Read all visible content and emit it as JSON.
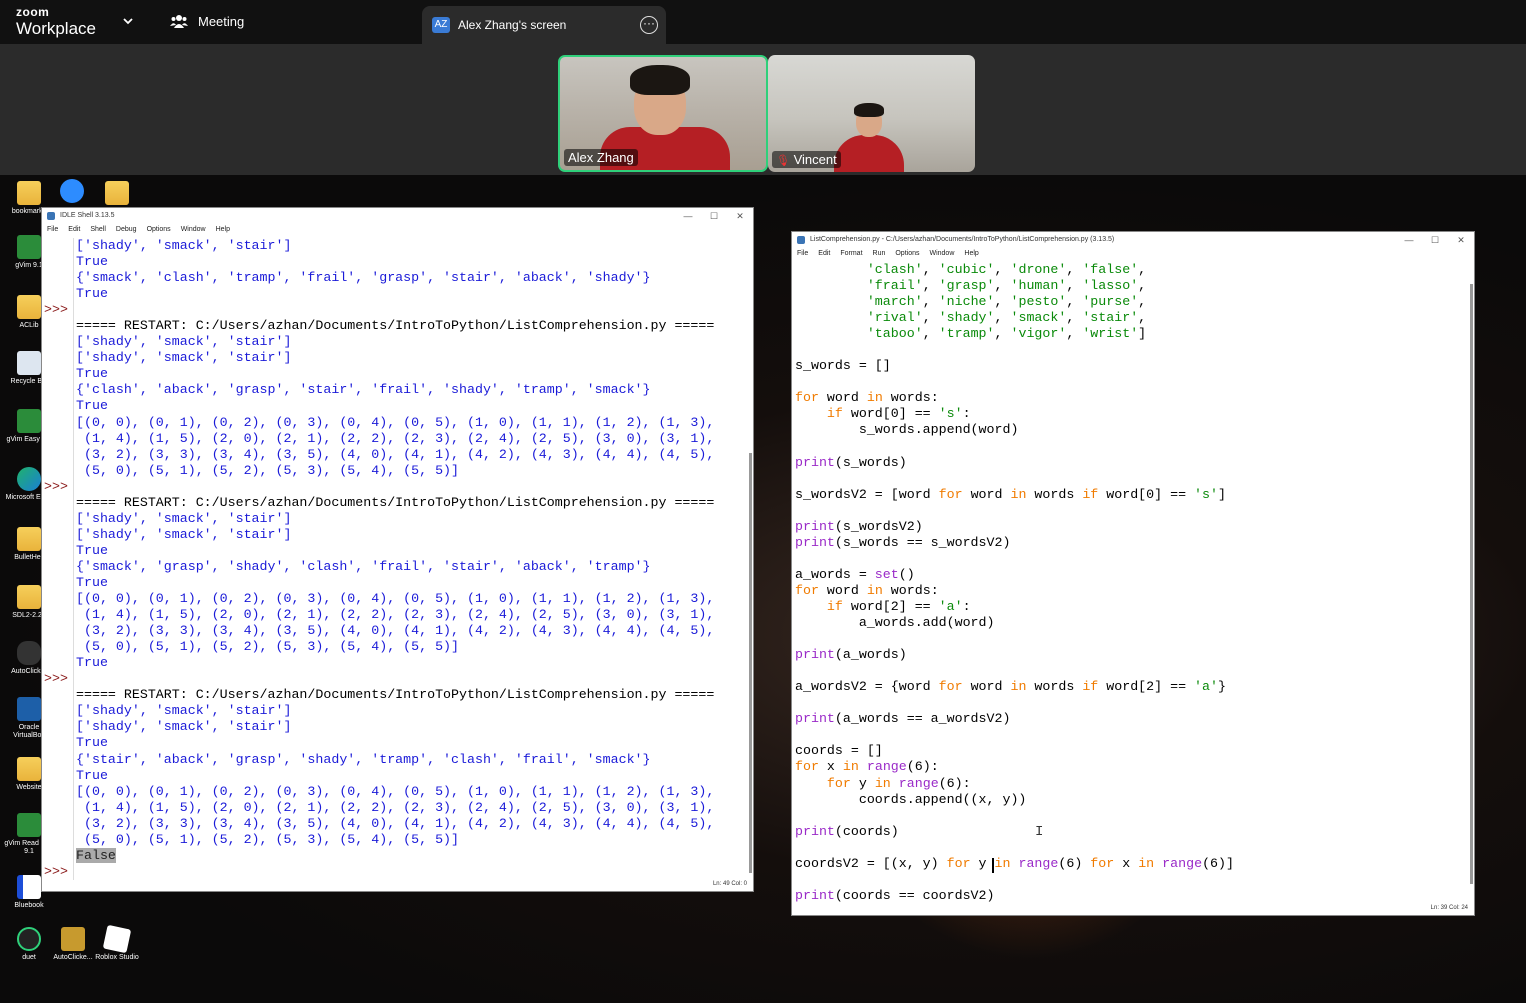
{
  "zoom": {
    "logo_top": "zoom",
    "logo_bottom": "Workplace",
    "meeting_label": "Meeting",
    "share_tab": {
      "avatar": "AZ",
      "title": "Alex Zhang's screen"
    }
  },
  "participants": [
    {
      "name": "Alex Zhang"
    },
    {
      "name": "Vincent",
      "muted": true
    }
  ],
  "desktop_icons": [
    {
      "label": "bookmarks"
    },
    {
      "label": "gVim 9.1"
    },
    {
      "label": "ACLib"
    },
    {
      "label": "Recycle Bin"
    },
    {
      "label": "gVim Easy 9.1"
    },
    {
      "label": "Microsoft Edge"
    },
    {
      "label": "BulletHell"
    },
    {
      "label": "SDL2-2.28"
    },
    {
      "label": "AutoClicker"
    },
    {
      "label": "Oracle VirtualBox"
    },
    {
      "label": "Website"
    },
    {
      "label": "gVim Read only 9.1"
    },
    {
      "label": "Bluebook"
    },
    {
      "label": "duet"
    },
    {
      "label": "AutoClicke..."
    },
    {
      "label": "Roblox Studio"
    }
  ],
  "idle_shell": {
    "title": "IDLE Shell 3.13.5",
    "menu": [
      "File",
      "Edit",
      "Shell",
      "Debug",
      "Options",
      "Window",
      "Help"
    ],
    "status": "Ln: 49   Col: 0",
    "prompt": ">>>",
    "lines": [
      {
        "p": "",
        "t": "['shady', 'smack', 'stair']",
        "c": "blue"
      },
      {
        "p": "",
        "t": "True",
        "c": "blue"
      },
      {
        "p": "",
        "t": "{'smack', 'clash', 'tramp', 'frail', 'grasp', 'stair', 'aback', 'shady'}",
        "c": "blue"
      },
      {
        "p": "",
        "t": "True",
        "c": "blue"
      },
      {
        "p": ">>>",
        "t": "",
        "c": ""
      },
      {
        "p": "",
        "t": "===== RESTART: C:/Users/azhan/Documents/IntroToPython/ListComprehension.py =====",
        "c": ""
      },
      {
        "p": "",
        "t": "['shady', 'smack', 'stair']",
        "c": "blue"
      },
      {
        "p": "",
        "t": "['shady', 'smack', 'stair']",
        "c": "blue"
      },
      {
        "p": "",
        "t": "True",
        "c": "blue"
      },
      {
        "p": "",
        "t": "{'clash', 'aback', 'grasp', 'stair', 'frail', 'shady', 'tramp', 'smack'}",
        "c": "blue"
      },
      {
        "p": "",
        "t": "True",
        "c": "blue"
      },
      {
        "p": "",
        "t": "[(0, 0), (0, 1), (0, 2), (0, 3), (0, 4), (0, 5), (1, 0), (1, 1), (1, 2), (1, 3),",
        "c": "blue"
      },
      {
        "p": "",
        "t": " (1, 4), (1, 5), (2, 0), (2, 1), (2, 2), (2, 3), (2, 4), (2, 5), (3, 0), (3, 1),",
        "c": "blue"
      },
      {
        "p": "",
        "t": " (3, 2), (3, 3), (3, 4), (3, 5), (4, 0), (4, 1), (4, 2), (4, 3), (4, 4), (4, 5),",
        "c": "blue"
      },
      {
        "p": "",
        "t": " (5, 0), (5, 1), (5, 2), (5, 3), (5, 4), (5, 5)]",
        "c": "blue"
      },
      {
        "p": ">>>",
        "t": "",
        "c": ""
      },
      {
        "p": "",
        "t": "===== RESTART: C:/Users/azhan/Documents/IntroToPython/ListComprehension.py =====",
        "c": ""
      },
      {
        "p": "",
        "t": "['shady', 'smack', 'stair']",
        "c": "blue"
      },
      {
        "p": "",
        "t": "['shady', 'smack', 'stair']",
        "c": "blue"
      },
      {
        "p": "",
        "t": "True",
        "c": "blue"
      },
      {
        "p": "",
        "t": "{'smack', 'grasp', 'shady', 'clash', 'frail', 'stair', 'aback', 'tramp'}",
        "c": "blue"
      },
      {
        "p": "",
        "t": "True",
        "c": "blue"
      },
      {
        "p": "",
        "t": "[(0, 0), (0, 1), (0, 2), (0, 3), (0, 4), (0, 5), (1, 0), (1, 1), (1, 2), (1, 3),",
        "c": "blue"
      },
      {
        "p": "",
        "t": " (1, 4), (1, 5), (2, 0), (2, 1), (2, 2), (2, 3), (2, 4), (2, 5), (3, 0), (3, 1),",
        "c": "blue"
      },
      {
        "p": "",
        "t": " (3, 2), (3, 3), (3, 4), (3, 5), (4, 0), (4, 1), (4, 2), (4, 3), (4, 4), (4, 5),",
        "c": "blue"
      },
      {
        "p": "",
        "t": " (5, 0), (5, 1), (5, 2), (5, 3), (5, 4), (5, 5)]",
        "c": "blue"
      },
      {
        "p": "",
        "t": "True",
        "c": "blue"
      },
      {
        "p": ">>>",
        "t": "",
        "c": ""
      },
      {
        "p": "",
        "t": "===== RESTART: C:/Users/azhan/Documents/IntroToPython/ListComprehension.py =====",
        "c": ""
      },
      {
        "p": "",
        "t": "['shady', 'smack', 'stair']",
        "c": "blue"
      },
      {
        "p": "",
        "t": "['shady', 'smack', 'stair']",
        "c": "blue"
      },
      {
        "p": "",
        "t": "True",
        "c": "blue"
      },
      {
        "p": "",
        "t": "{'stair', 'aback', 'grasp', 'shady', 'tramp', 'clash', 'frail', 'smack'}",
        "c": "blue"
      },
      {
        "p": "",
        "t": "True",
        "c": "blue"
      },
      {
        "p": "",
        "t": "[(0, 0), (0, 1), (0, 2), (0, 3), (0, 4), (0, 5), (1, 0), (1, 1), (1, 2), (1, 3),",
        "c": "blue"
      },
      {
        "p": "",
        "t": " (1, 4), (1, 5), (2, 0), (2, 1), (2, 2), (2, 3), (2, 4), (2, 5), (3, 0), (3, 1),",
        "c": "blue"
      },
      {
        "p": "",
        "t": " (3, 2), (3, 3), (3, 4), (3, 5), (4, 0), (4, 1), (4, 2), (4, 3), (4, 4), (4, 5),",
        "c": "blue"
      },
      {
        "p": "",
        "t": " (5, 0), (5, 1), (5, 2), (5, 3), (5, 4), (5, 5)]",
        "c": "blue"
      },
      {
        "p": "",
        "t": "False",
        "c": "sel"
      },
      {
        "p": ">>>",
        "t": "",
        "c": ""
      }
    ]
  },
  "editor": {
    "title": "ListComprehension.py - C:/Users/azhan/Documents/IntroToPython/ListComprehension.py (3.13.5)",
    "menu": [
      "File",
      "Edit",
      "Format",
      "Run",
      "Options",
      "Window",
      "Help"
    ],
    "status": "Ln: 39   Col: 24",
    "lines": [
      [
        [
          "         ",
          ""
        ],
        [
          "'clash'",
          "str"
        ],
        [
          ", ",
          ""
        ],
        [
          "'cubic'",
          "str"
        ],
        [
          ", ",
          ""
        ],
        [
          "'drone'",
          "str"
        ],
        [
          ", ",
          ""
        ],
        [
          "'false'",
          "str"
        ],
        [
          ",",
          ""
        ]
      ],
      [
        [
          "         ",
          ""
        ],
        [
          "'frail'",
          "str"
        ],
        [
          ", ",
          ""
        ],
        [
          "'grasp'",
          "str"
        ],
        [
          ", ",
          ""
        ],
        [
          "'human'",
          "str"
        ],
        [
          ", ",
          ""
        ],
        [
          "'lasso'",
          "str"
        ],
        [
          ",",
          ""
        ]
      ],
      [
        [
          "         ",
          ""
        ],
        [
          "'march'",
          "str"
        ],
        [
          ", ",
          ""
        ],
        [
          "'niche'",
          "str"
        ],
        [
          ", ",
          ""
        ],
        [
          "'pesto'",
          "str"
        ],
        [
          ", ",
          ""
        ],
        [
          "'purse'",
          "str"
        ],
        [
          ",",
          ""
        ]
      ],
      [
        [
          "         ",
          ""
        ],
        [
          "'rival'",
          "str"
        ],
        [
          ", ",
          ""
        ],
        [
          "'shady'",
          "str"
        ],
        [
          ", ",
          ""
        ],
        [
          "'smack'",
          "str"
        ],
        [
          ", ",
          ""
        ],
        [
          "'stair'",
          "str"
        ],
        [
          ",",
          ""
        ]
      ],
      [
        [
          "         ",
          ""
        ],
        [
          "'taboo'",
          "str"
        ],
        [
          ", ",
          ""
        ],
        [
          "'tramp'",
          "str"
        ],
        [
          ", ",
          ""
        ],
        [
          "'vigor'",
          "str"
        ],
        [
          ", ",
          ""
        ],
        [
          "'wrist'",
          "str"
        ],
        [
          "]",
          ""
        ]
      ],
      [],
      [
        [
          "s_words = []",
          ""
        ]
      ],
      [],
      [
        [
          "for",
          "kw"
        ],
        [
          " word ",
          ""
        ],
        [
          "in",
          "kw"
        ],
        [
          " words:",
          ""
        ]
      ],
      [
        [
          "    ",
          ""
        ],
        [
          "if",
          "kw"
        ],
        [
          " word[0] == ",
          ""
        ],
        [
          "'s'",
          "str"
        ],
        [
          ":",
          ""
        ]
      ],
      [
        [
          "        s_words.append(word)",
          ""
        ]
      ],
      [],
      [
        [
          "print",
          "bi"
        ],
        [
          "(s_words)",
          ""
        ]
      ],
      [],
      [
        [
          "s_wordsV2 = [word ",
          ""
        ],
        [
          "for",
          "kw"
        ],
        [
          " word ",
          ""
        ],
        [
          "in",
          "kw"
        ],
        [
          " words ",
          ""
        ],
        [
          "if",
          "kw"
        ],
        [
          " word[0] == ",
          ""
        ],
        [
          "'s'",
          "str"
        ],
        [
          "]",
          ""
        ]
      ],
      [],
      [
        [
          "print",
          "bi"
        ],
        [
          "(s_wordsV2)",
          ""
        ]
      ],
      [
        [
          "print",
          "bi"
        ],
        [
          "(s_words == s_wordsV2)",
          ""
        ]
      ],
      [],
      [
        [
          "a_words = ",
          ""
        ],
        [
          "set",
          "bi"
        ],
        [
          "()",
          ""
        ]
      ],
      [
        [
          "for",
          "kw"
        ],
        [
          " word ",
          ""
        ],
        [
          "in",
          "kw"
        ],
        [
          " words:",
          ""
        ]
      ],
      [
        [
          "    ",
          ""
        ],
        [
          "if",
          "kw"
        ],
        [
          " word[2] == ",
          ""
        ],
        [
          "'a'",
          "str"
        ],
        [
          ":",
          ""
        ]
      ],
      [
        [
          "        a_words.add(word)",
          ""
        ]
      ],
      [],
      [
        [
          "print",
          "bi"
        ],
        [
          "(a_words)",
          ""
        ]
      ],
      [],
      [
        [
          "a_wordsV2 = {word ",
          ""
        ],
        [
          "for",
          "kw"
        ],
        [
          " word ",
          ""
        ],
        [
          "in",
          "kw"
        ],
        [
          " words ",
          ""
        ],
        [
          "if",
          "kw"
        ],
        [
          " word[2] == ",
          ""
        ],
        [
          "'a'",
          "str"
        ],
        [
          "}",
          ""
        ]
      ],
      [],
      [
        [
          "print",
          "bi"
        ],
        [
          "(a_words == a_wordsV2)",
          ""
        ]
      ],
      [],
      [
        [
          "coords = []",
          ""
        ]
      ],
      [
        [
          "for",
          "kw"
        ],
        [
          " x ",
          ""
        ],
        [
          "in",
          "kw"
        ],
        [
          " ",
          ""
        ],
        [
          "range",
          "bi"
        ],
        [
          "(6):",
          ""
        ]
      ],
      [
        [
          "    ",
          ""
        ],
        [
          "for",
          "kw"
        ],
        [
          " y ",
          ""
        ],
        [
          "in",
          "kw"
        ],
        [
          " ",
          ""
        ],
        [
          "range",
          "bi"
        ],
        [
          "(6):",
          ""
        ]
      ],
      [
        [
          "        coords.append((x, y))",
          ""
        ]
      ],
      [],
      [
        [
          "print",
          "bi"
        ],
        [
          "(coords)",
          ""
        ]
      ],
      [],
      [
        [
          "coordsV2 = [(x, y) ",
          ""
        ],
        [
          "for",
          "kw"
        ],
        [
          " y ",
          ""
        ],
        [
          "in",
          "kw"
        ],
        [
          " ",
          ""
        ],
        [
          "range",
          "bi"
        ],
        [
          "(6) ",
          ""
        ],
        [
          "for",
          "kw"
        ],
        [
          " x ",
          ""
        ],
        [
          "in",
          "kw"
        ],
        [
          " ",
          ""
        ],
        [
          "range",
          "bi"
        ],
        [
          "(6)]",
          ""
        ]
      ],
      [],
      [
        [
          "print",
          "bi"
        ],
        [
          "(coords == coordsV2)",
          ""
        ]
      ]
    ]
  }
}
